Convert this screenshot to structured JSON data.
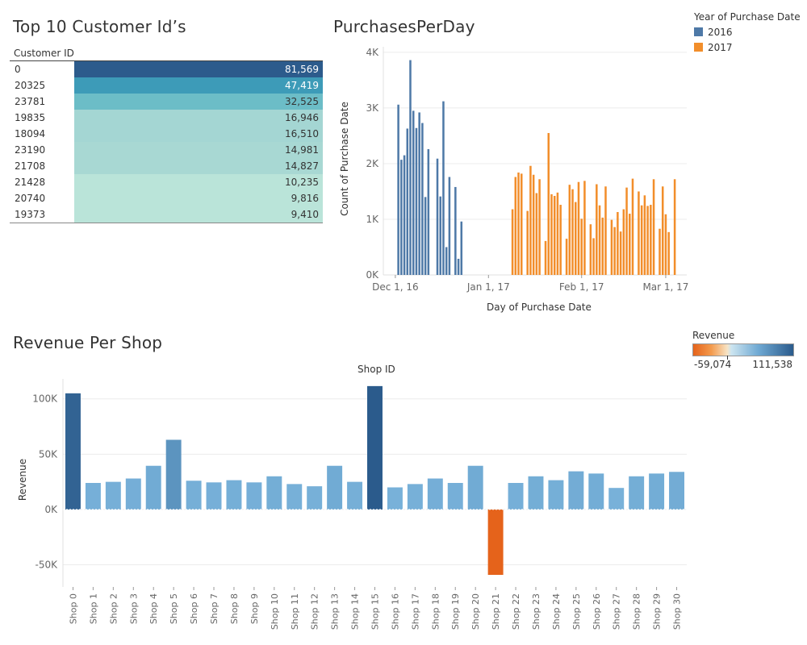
{
  "top10": {
    "title": "Top 10 Customer Id’s",
    "column_header": "Customer ID",
    "rows": [
      {
        "id": "0",
        "value": "81,569",
        "bg": "#2c5b8c",
        "fg": "#ffffff"
      },
      {
        "id": "20325",
        "value": "47,419",
        "bg": "#3d9bb8",
        "fg": "#ffffff"
      },
      {
        "id": "23781",
        "value": "32,525",
        "bg": "#6cbdc7",
        "fg": "#333333"
      },
      {
        "id": "19835",
        "value": "16,946",
        "bg": "#a4d6d3",
        "fg": "#333333"
      },
      {
        "id": "18094",
        "value": "16,510",
        "bg": "#a4d6d3",
        "fg": "#333333"
      },
      {
        "id": "23190",
        "value": "14,981",
        "bg": "#a8d8d3",
        "fg": "#333333"
      },
      {
        "id": "21708",
        "value": "14,827",
        "bg": "#a8d8d3",
        "fg": "#333333"
      },
      {
        "id": "21428",
        "value": "10,235",
        "bg": "#bae4d9",
        "fg": "#333333"
      },
      {
        "id": "20740",
        "value": "9,816",
        "bg": "#bae4d9",
        "fg": "#333333"
      },
      {
        "id": "19373",
        "value": "9,410",
        "bg": "#bae4d9",
        "fg": "#333333"
      }
    ]
  },
  "purchases": {
    "title": "PurchasesPerDay",
    "ylabel": "Count of Purchase Date",
    "xlabel": "Day of Purchase Date",
    "y_ticks": [
      "4K",
      "3K",
      "2K",
      "1K",
      "0K"
    ],
    "x_ticks": [
      "Dec 1, 16",
      "Jan 1, 17",
      "Feb 1, 17",
      "Mar 1, 17"
    ],
    "legend_title": "Year of Purchase Date",
    "legend": [
      {
        "label": "2016",
        "color": "#4e79a7"
      },
      {
        "label": "2017",
        "color": "#f28e2b"
      }
    ]
  },
  "revenue": {
    "title": "Revenue Per Shop",
    "top_label": "Shop ID",
    "ylabel": "Revenue",
    "y_ticks": [
      "100K",
      "50K",
      "0K",
      "-50K"
    ],
    "legend_title": "Revenue",
    "legend_min": "-59,074",
    "legend_max": "111,538"
  },
  "chart_data": [
    {
      "type": "bar",
      "title": "PurchasesPerDay",
      "xlabel": "Day of Purchase Date",
      "ylabel": "Count of Purchase Date",
      "ylim": [
        0,
        4100
      ],
      "grid": true,
      "legend_placement": "top-right",
      "series": [
        {
          "name": "2016",
          "color": "#4e79a7",
          "x": [
            "2016-12-02",
            "2016-12-03",
            "2016-12-04",
            "2016-12-05",
            "2016-12-06",
            "2016-12-07",
            "2016-12-08",
            "2016-12-09",
            "2016-12-10",
            "2016-12-11",
            "2016-12-12",
            "2016-12-15",
            "2016-12-16",
            "2016-12-17",
            "2016-12-18",
            "2016-12-19",
            "2016-12-21",
            "2016-12-22",
            "2016-12-23",
            "2016-12-24",
            "2016-12-25"
          ],
          "values": [
            3060,
            2070,
            2150,
            2630,
            3860,
            2950,
            2640,
            2920,
            2730,
            1400,
            2260,
            2090,
            1410,
            3120,
            500,
            1760,
            1580,
            290,
            960,
            0,
            0
          ]
        },
        {
          "name": "2017",
          "color": "#f28e2b",
          "x": [
            "2017-01-09",
            "2017-01-10",
            "2017-01-11",
            "2017-01-12",
            "2017-01-14",
            "2017-01-15",
            "2017-01-16",
            "2017-01-17",
            "2017-01-18",
            "2017-01-20",
            "2017-01-21",
            "2017-01-22",
            "2017-01-23",
            "2017-01-24",
            "2017-01-25",
            "2017-01-27",
            "2017-01-28",
            "2017-01-29",
            "2017-01-30",
            "2017-01-31",
            "2017-02-01",
            "2017-02-02",
            "2017-02-04",
            "2017-02-05",
            "2017-02-06",
            "2017-02-07",
            "2017-02-08",
            "2017-02-09",
            "2017-02-11",
            "2017-02-12",
            "2017-02-13",
            "2017-02-14",
            "2017-02-15",
            "2017-02-16",
            "2017-02-17",
            "2017-02-18",
            "2017-02-20",
            "2017-02-21",
            "2017-02-22",
            "2017-02-23",
            "2017-02-24",
            "2017-02-25",
            "2017-02-27",
            "2017-02-28",
            "2017-03-01",
            "2017-03-02",
            "2017-03-04"
          ],
          "values": [
            1180,
            1760,
            1840,
            1820,
            1150,
            1960,
            1800,
            1470,
            1720,
            610,
            2550,
            1450,
            1420,
            1480,
            1260,
            650,
            1620,
            1540,
            1310,
            1670,
            1010,
            1690,
            910,
            660,
            1630,
            1250,
            1030,
            1590,
            990,
            860,
            1130,
            780,
            1180,
            1570,
            1100,
            1730,
            1500,
            1250,
            1430,
            1240,
            1260,
            1720,
            830,
            1590,
            1090,
            770,
            1720
          ]
        }
      ]
    },
    {
      "type": "bar",
      "title": "Revenue Per Shop",
      "xlabel": "Shop ID",
      "ylabel": "Revenue",
      "ylim": [
        -70000,
        118000
      ],
      "grid": true,
      "color_legend": {
        "title": "Revenue",
        "min": -59074,
        "max": 111538
      },
      "categories": [
        "Shop 0",
        "Shop 1",
        "Shop 2",
        "Shop 3",
        "Shop 4",
        "Shop 5",
        "Shop 6",
        "Shop 7",
        "Shop 8",
        "Shop 9",
        "Shop 10",
        "Shop 11",
        "Shop 12",
        "Shop 13",
        "Shop 14",
        "Shop 15",
        "Shop 16",
        "Shop 17",
        "Shop 18",
        "Shop 19",
        "Shop 20",
        "Shop 21",
        "Shop 22",
        "Shop 23",
        "Shop 24",
        "Shop 25",
        "Shop 26",
        "Shop 27",
        "Shop 28",
        "Shop 29",
        "Shop 30"
      ],
      "values": [
        105000,
        24000,
        25000,
        28000,
        39500,
        63000,
        26000,
        24500,
        26500,
        24500,
        30000,
        23000,
        21000,
        39500,
        25000,
        111538,
        20000,
        23000,
        28000,
        24000,
        39500,
        -59074,
        24000,
        30000,
        26500,
        34500,
        32500,
        19500,
        30000,
        32500,
        34000
      ]
    }
  ]
}
